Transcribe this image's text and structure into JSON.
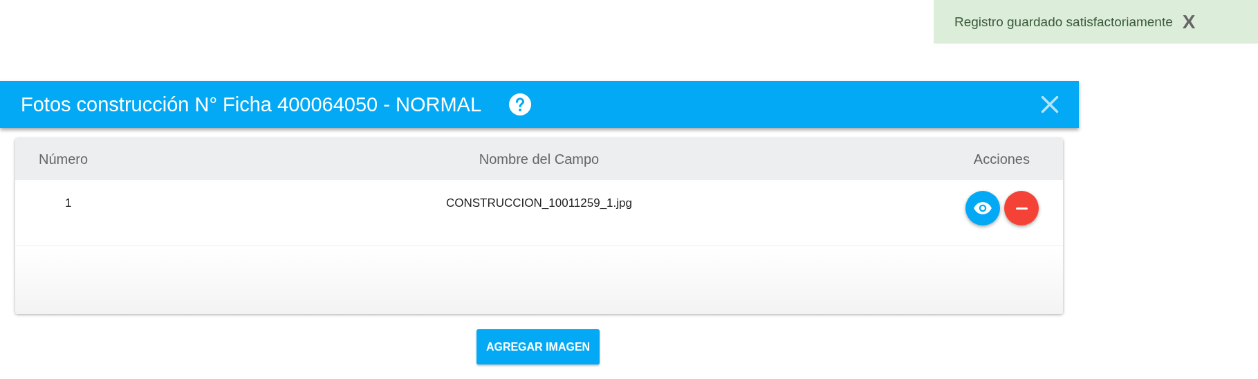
{
  "toast": {
    "message": "Registro guardado satisfactoriamente",
    "close": "X"
  },
  "dialog": {
    "title": "Fotos construcción N° Ficha 400064050 - NORMAL"
  },
  "table": {
    "columns": [
      "Número",
      "Nombre del Campo",
      "Acciones"
    ],
    "rows": [
      {
        "number": "1",
        "name": "CONSTRUCCION_10011259_1.jpg"
      }
    ]
  },
  "buttons": [
    "AGREGAR IMAGEN"
  ]
}
